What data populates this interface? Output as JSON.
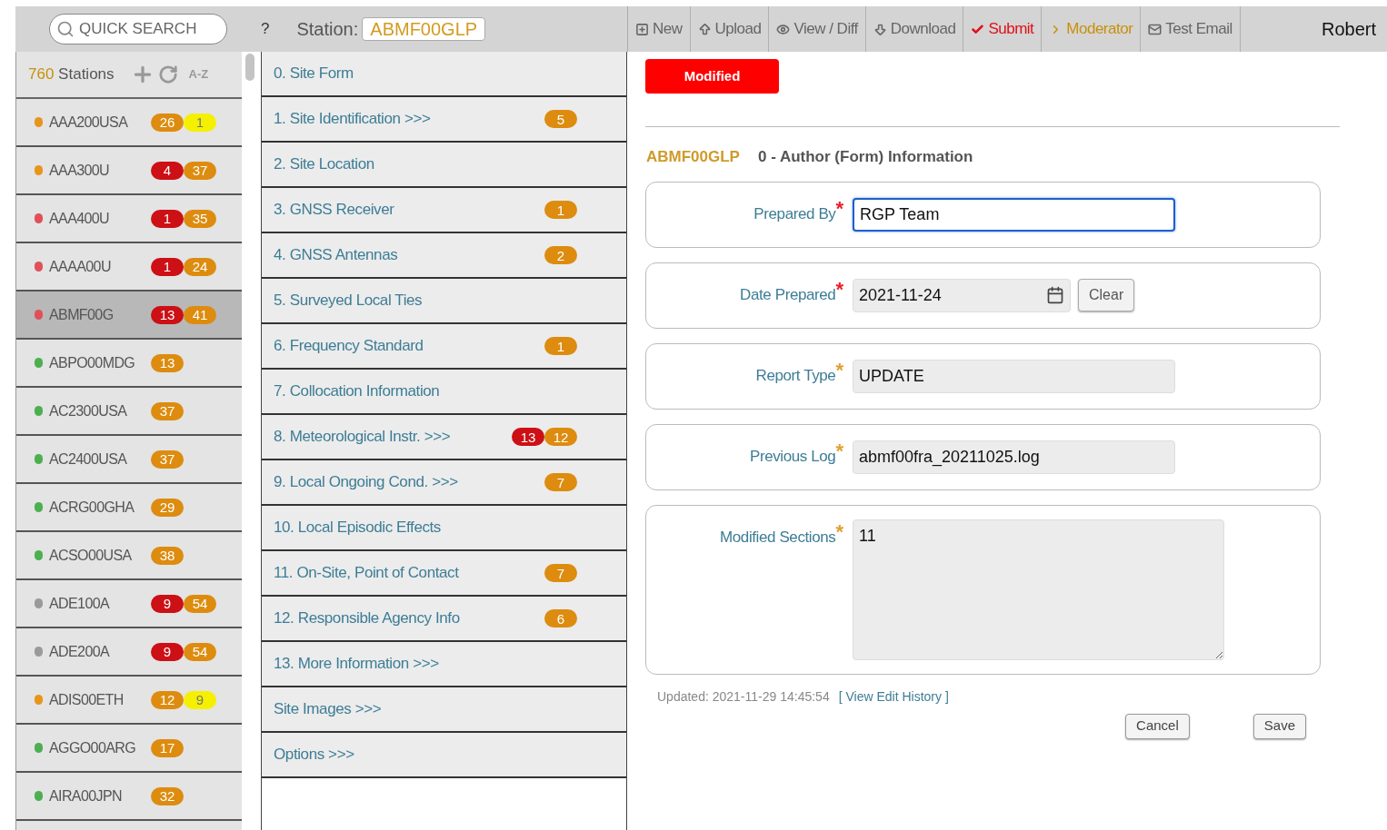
{
  "top_bar": {
    "search": {
      "placeholder": "QUICK SEARCH"
    },
    "help": "?",
    "station_label": "Station:",
    "station_value": "ABMF00GLP",
    "actions": [
      {
        "label": "New",
        "kind": "plain"
      },
      {
        "label": "Upload",
        "kind": "plain"
      },
      {
        "label": "View / Diff",
        "kind": "plain"
      },
      {
        "label": "Download",
        "kind": "plain"
      },
      {
        "label": "Submit",
        "kind": "danger"
      },
      {
        "label": "Moderator",
        "kind": "warning"
      },
      {
        "label": "Test Email",
        "kind": "plain"
      }
    ],
    "user": "Robert"
  },
  "stations": {
    "count": "760",
    "label": "Stations",
    "sort": "A-Z",
    "items": [
      {
        "name": "AAA200USA",
        "color": "#e8951c",
        "selected": false,
        "badges": [
          {
            "text": "26",
            "kind": "count"
          },
          {
            "text": "1",
            "kind": "warning"
          }
        ]
      },
      {
        "name": "AAA300U",
        "color": "#e8951c",
        "selected": false,
        "badges": [
          {
            "text": "4",
            "kind": "error"
          },
          {
            "text": "37",
            "kind": "count"
          }
        ]
      },
      {
        "name": "AAA400U",
        "color": "#e0505a",
        "selected": false,
        "badges": [
          {
            "text": "1",
            "kind": "error"
          },
          {
            "text": "35",
            "kind": "count"
          }
        ]
      },
      {
        "name": "AAAA00U",
        "color": "#e0505a",
        "selected": false,
        "badges": [
          {
            "text": "1",
            "kind": "error"
          },
          {
            "text": "24",
            "kind": "count"
          }
        ]
      },
      {
        "name": "ABMF00G",
        "color": "#e0505a",
        "selected": true,
        "badges": [
          {
            "text": "13",
            "kind": "error"
          },
          {
            "text": "41",
            "kind": "count"
          }
        ]
      },
      {
        "name": "ABPO00MDG",
        "color": "#4caf50",
        "selected": false,
        "badges": [
          {
            "text": "13",
            "kind": "count"
          }
        ]
      },
      {
        "name": "AC2300USA",
        "color": "#4caf50",
        "selected": false,
        "badges": [
          {
            "text": "37",
            "kind": "count"
          }
        ]
      },
      {
        "name": "AC2400USA",
        "color": "#4caf50",
        "selected": false,
        "badges": [
          {
            "text": "37",
            "kind": "count"
          }
        ]
      },
      {
        "name": "ACRG00GHA",
        "color": "#4caf50",
        "selected": false,
        "badges": [
          {
            "text": "29",
            "kind": "count"
          }
        ]
      },
      {
        "name": "ACSO00USA",
        "color": "#4caf50",
        "selected": false,
        "badges": [
          {
            "text": "38",
            "kind": "count"
          }
        ]
      },
      {
        "name": "ADE100A",
        "color": "#9a9a9a",
        "selected": false,
        "badges": [
          {
            "text": "9",
            "kind": "error"
          },
          {
            "text": "54",
            "kind": "count"
          }
        ]
      },
      {
        "name": "ADE200A",
        "color": "#9a9a9a",
        "selected": false,
        "badges": [
          {
            "text": "9",
            "kind": "error"
          },
          {
            "text": "54",
            "kind": "count"
          }
        ]
      },
      {
        "name": "ADIS00ETH",
        "color": "#e8951c",
        "selected": false,
        "badges": [
          {
            "text": "12",
            "kind": "count"
          },
          {
            "text": "9",
            "kind": "warning"
          }
        ]
      },
      {
        "name": "AGGO00ARG",
        "color": "#4caf50",
        "selected": false,
        "badges": [
          {
            "text": "17",
            "kind": "count"
          }
        ]
      },
      {
        "name": "AIRA00JPN",
        "color": "#4caf50",
        "selected": false,
        "badges": [
          {
            "text": "32",
            "kind": "count"
          }
        ]
      }
    ]
  },
  "sections": [
    {
      "label": "0. Site Form"
    },
    {
      "label": "1. Site Identification >>>",
      "badges": [
        {
          "text": "5",
          "kind": "count"
        }
      ]
    },
    {
      "label": "2. Site Location"
    },
    {
      "label": "3. GNSS Receiver",
      "badges": [
        {
          "text": "1",
          "kind": "count"
        }
      ]
    },
    {
      "label": "4. GNSS Antennas",
      "badges": [
        {
          "text": "2",
          "kind": "count"
        }
      ]
    },
    {
      "label": "5. Surveyed Local Ties"
    },
    {
      "label": "6. Frequency Standard",
      "badges": [
        {
          "text": "1",
          "kind": "count"
        }
      ]
    },
    {
      "label": "7. Collocation Information"
    },
    {
      "label": "8. Meteorological Instr. >>>",
      "badges": [
        {
          "text": "13",
          "kind": "error"
        },
        {
          "text": "12",
          "kind": "count"
        }
      ]
    },
    {
      "label": "9. Local Ongoing Cond. >>>",
      "badges": [
        {
          "text": "7",
          "kind": "count"
        }
      ]
    },
    {
      "label": "10. Local Episodic Effects"
    },
    {
      "label": "11. On-Site, Point of Contact",
      "badges": [
        {
          "text": "7",
          "kind": "count"
        }
      ]
    },
    {
      "label": "12. Responsible Agency Info",
      "badges": [
        {
          "text": "6",
          "kind": "count"
        }
      ]
    },
    {
      "label": "13. More Information >>>"
    },
    {
      "label": "Site Images >>>"
    },
    {
      "label": "Options >>>"
    }
  ],
  "form": {
    "status": "Modified",
    "station": "ABMF00GLP",
    "title": "0 - Author (Form) Information",
    "fields": [
      {
        "label": "Prepared By",
        "required_mark": "*",
        "color": "#e8202a",
        "kind": "input",
        "value": "RGP Team",
        "focused": true
      },
      {
        "label": "Date Prepared",
        "required_mark": "*",
        "color": "#e8202a",
        "kind": "date",
        "value": "2021-11-24",
        "focused": false,
        "clear": "Clear"
      },
      {
        "label": "Report Type",
        "required_mark": "*",
        "color": "#e0a030",
        "kind": "input",
        "value": "UPDATE",
        "focused": false
      },
      {
        "label": "Previous Log",
        "required_mark": "*",
        "color": "#e0a030",
        "kind": "input",
        "value": "abmf00fra_20211025.log",
        "focused": false
      },
      {
        "label": "Modified Sections",
        "required_mark": "*",
        "color": "#e0a030",
        "kind": "textarea",
        "value": "11",
        "focused": false
      }
    ],
    "updated": "Updated: 2021-11-29 14:45:54",
    "history_link": "[ View Edit History ]",
    "buttons": [
      "Cancel",
      "Save"
    ]
  }
}
